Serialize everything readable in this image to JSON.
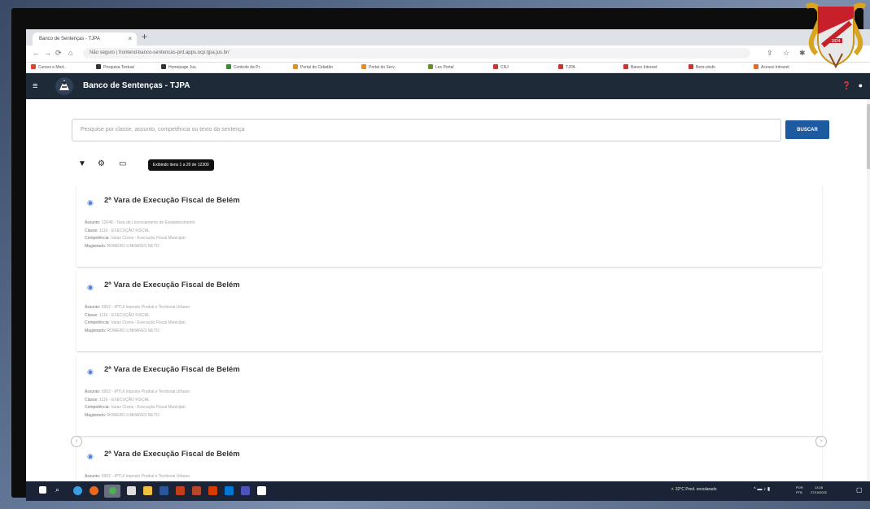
{
  "browser": {
    "tab_title": "Banco de Sentenças - TJPA",
    "url": "Não seguro | frontend-banco-sentencas-prd.apps.ocp.tjpa.jus.br/",
    "bookmarks": [
      "Cursos e Mod..",
      "Pesquisa Textual",
      "Homepage Jus.",
      "Controle de Pr..",
      "Portal do Cidadão",
      "Portal do Serv..",
      "Lex Portal",
      "CNJ",
      "TJPA",
      "Banco Intranet",
      "Bem-vindo",
      "Acesso Intranet"
    ]
  },
  "appbar": {
    "title": "Banco de Sentenças - TJPA"
  },
  "search": {
    "placeholder": "Pesquise por classe, assunto, competência ou texto da sentença",
    "button_label": "BUSCAR"
  },
  "toolbar": {
    "results_badge": "Exibindo itens 1 a 20 de 12300"
  },
  "cards": [
    {
      "title": "2ª Vara de Execução Fiscal de Belém",
      "assunto_label": "Assunto:",
      "assunto": "12048 - Taxa de Licenciamento de Estabelecimento",
      "classe_label": "Classe:",
      "classe": "1116 - EXECUÇÃO FISCAL",
      "competencia_label": "Competência:",
      "competencia": "Varas Cíveis - Execução Fiscal Municipal",
      "magistrado_label": "Magistrado:",
      "magistrado": "ROMERO LINHARES NETO"
    },
    {
      "title": "2ª Vara de Execução Fiscal de Belém",
      "assunto_label": "Assunto:",
      "assunto": "5952 - IPTU/ Imposto Predial e Territorial Urbano",
      "classe_label": "Classe:",
      "classe": "1116 - EXECUÇÃO FISCAL",
      "competencia_label": "Competência:",
      "competencia": "Varas Cíveis - Execução Fiscal Municipal",
      "magistrado_label": "Magistrado:",
      "magistrado": "ROMERO LINHARES NETO"
    },
    {
      "title": "2ª Vara de Execução Fiscal de Belém",
      "assunto_label": "Assunto:",
      "assunto": "5952 - IPTU/ Imposto Predial e Territorial Urbano",
      "classe_label": "Classe:",
      "classe": "1116 - EXECUÇÃO FISCAL",
      "competencia_label": "Competência:",
      "competencia": "Varas Cíveis - Execução Fiscal Municipal",
      "magistrado_label": "Magistrado:",
      "magistrado": "ROMERO LINHARES NETO"
    },
    {
      "title": "2ª Vara de Execução Fiscal de Belém",
      "assunto_label": "Assunto:",
      "assunto": "5952 - IPTU/ Imposto Predial e Territorial Urbano",
      "classe_label": "",
      "classe": "",
      "competencia_label": "",
      "competencia": "",
      "magistrado_label": "",
      "magistrado": ""
    }
  ],
  "taskbar": {
    "weather": "32°C  Pred. ensolarado",
    "lang_top": "POR",
    "lang_bottom": "PTB",
    "time": "13:28",
    "date": "27/10/2022"
  },
  "emblem": {
    "year": "1824"
  },
  "colors": {
    "appbar": "#1e2a38",
    "button": "#1e5aa0",
    "eye_icon": "#4a7fd4"
  }
}
